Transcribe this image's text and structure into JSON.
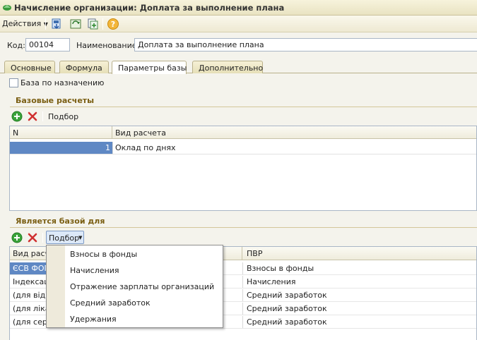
{
  "window": {
    "title": "Начисление организации: Доплата за выполнение плана"
  },
  "toolbar": {
    "actions_label": "Действия"
  },
  "form": {
    "code_label": "Код:",
    "code_value": "00104",
    "name_label": "Наименование:",
    "name_value": "Доплата за выполнение плана"
  },
  "tabs": [
    {
      "label": "Основные"
    },
    {
      "label": "Формула"
    },
    {
      "label": "Параметры базы"
    },
    {
      "label": "Дополнительно"
    }
  ],
  "base_by_purpose": {
    "label": "База по назначению",
    "checked": false
  },
  "base_calcs": {
    "title": "Базовые расчеты",
    "pick_label": "Подбор",
    "columns": [
      "N",
      "Вид расчета"
    ],
    "rows": [
      {
        "n": "1",
        "kind": "Оклад по днях"
      }
    ]
  },
  "is_base_for": {
    "title": "Является базой для",
    "pick_label": "Подбор",
    "columns": [
      "Вид расче",
      "ПВР"
    ],
    "rows": [
      {
        "kind": "ЄСВ ФОП",
        "pvr": "Взносы в фонды"
      },
      {
        "kind": "Індексаці",
        "pvr": "Начисления"
      },
      {
        "kind": "(для відпу",
        "pvr": "Средний заработок"
      },
      {
        "kind": "(для лікар",
        "pvr": "Средний заработок"
      },
      {
        "kind": "(для сере",
        "pvr": "Средний заработок"
      }
    ]
  },
  "pick_menu": {
    "items": [
      "Взносы в фонды",
      "Начисления",
      "Отражение зарплаты организаций",
      "Средний заработок",
      "Удержания"
    ]
  },
  "colors": {
    "selection": "#5f88c4",
    "section_title": "#7a5e12",
    "add_green": "#3aa33a",
    "delete_red": "#d03030"
  }
}
